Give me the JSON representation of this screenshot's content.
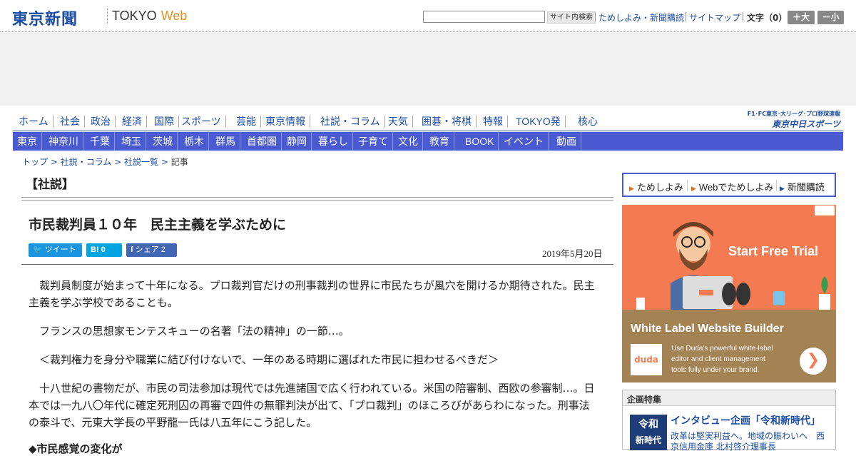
{
  "header": {
    "logo_text": "東京新聞",
    "logo_sub": "TOKYO",
    "logo_web": "Web",
    "search_button": "サイト内検索",
    "links": [
      "ためしよみ・新聞購読",
      "サイトマップ"
    ],
    "font_size_label": "文字（0）",
    "font_larger": "＋大",
    "font_smaller": "－小"
  },
  "nav_primary": [
    "ホーム",
    "社会",
    "政治",
    "経済",
    "国際",
    "スポーツ",
    "芸能",
    "東京情報",
    "社説・コラム",
    "天気",
    "囲碁・将棋",
    "特報",
    "TOKYO発",
    "核心"
  ],
  "chunichi": {
    "tagline": "F1･FC東京･大リーグ･プロ野球速報",
    "name": "東京中日スポーツ"
  },
  "nav_regional": [
    "東京",
    "神奈川",
    "千葉",
    "埼玉",
    "茨城",
    "栃木",
    "群馬",
    "首都圏",
    "静岡",
    "暮らし",
    "子育て",
    "文化",
    "教育",
    "BOOK",
    "イベント",
    "動画"
  ],
  "breadcrumb": {
    "items": [
      "トップ",
      "社説・コラム",
      "社説一覧"
    ],
    "current": "記事",
    "sep": " > "
  },
  "section_heading": "【社説】",
  "article": {
    "title": "市民裁判員１０年　民主主義を学ぶために",
    "date": "2019年5月20日",
    "share": {
      "tweet": "ツイート",
      "hatena_count": "0",
      "facebook": "シェア",
      "facebook_count": "2"
    },
    "paragraphs": [
      "　裁判員制度が始まって十年になる。プロ裁判官だけの刑事裁判の世界に市民たちが風穴を開けるか期待された。民主主義を学ぶ学校であることも。",
      "　フランスの思想家モンテスキューの名著「法の精神」の一節…。",
      "　＜裁判権力を身分や職業に結び付けないで、一年のある時期に選ばれた市民に担わせるべきだ＞",
      "　十八世紀の書物だが、市民の司法参加は現代では先進諸国で広く行われている。米国の陪審制、西欧の参審制…。日本では一九八〇年代に確定死刑囚の再審で四件の無罪判決が出て、「プロ裁判」のほころびがあらわになった。刑事法の泰斗で、元東大学長の平野龍一氏は八五年にこう記した。"
    ],
    "sub_heading": "◆市民感覚の変化が"
  },
  "sidebar": {
    "links": [
      "ためしよみ",
      "Webでためしよみ",
      "新聞購読"
    ],
    "ad": {
      "cta": "Start Free Trial",
      "headline": "White Label Website Builder",
      "logo": "duda",
      "description": "Use Duda's powerful white-label editor and client management tools fully under your brand.",
      "arrow": "❯"
    },
    "feature": {
      "heading": "企画特集",
      "thumb_line1": "令和",
      "thumb_line2": "新時代",
      "title": "インタビュー企画「令和新時代」",
      "body": "改革は堅実利益へ。地域の賑わいへ　西京信用金庫 北村啓介理事長"
    }
  }
}
